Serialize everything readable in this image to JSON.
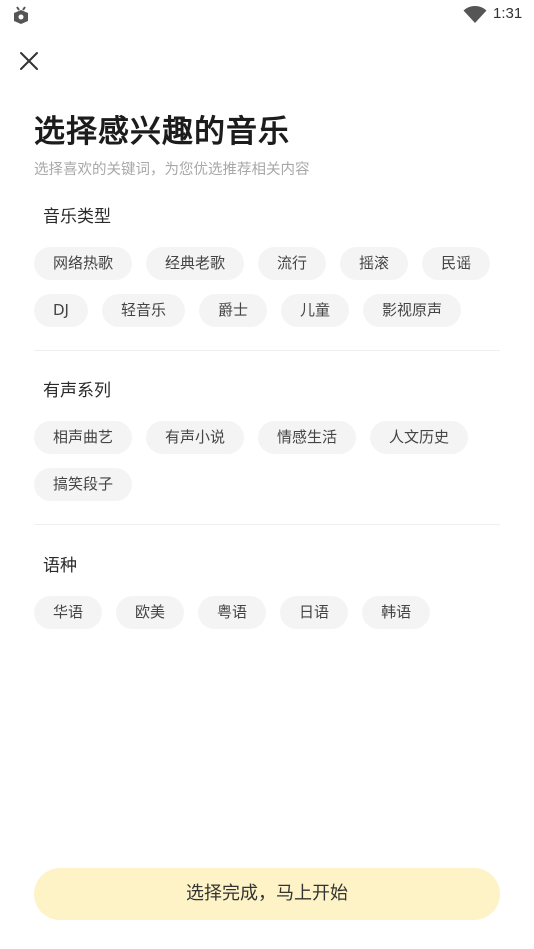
{
  "status_bar": {
    "time": "1:31",
    "icons": [
      "app-notification-icon",
      "wifi-icon"
    ]
  },
  "header": {
    "close_icon": "close-icon",
    "title": "选择感兴趣的音乐",
    "subtitle": "选择喜欢的关键词，为您优选推荐相关内容"
  },
  "sections": [
    {
      "title": "音乐类型",
      "tags": [
        "网络热歌",
        "经典老歌",
        "流行",
        "摇滚",
        "民谣",
        "DJ",
        "轻音乐",
        "爵士",
        "儿童",
        "影视原声"
      ]
    },
    {
      "title": "有声系列",
      "tags": [
        "相声曲艺",
        "有声小说",
        "情感生活",
        "人文历史",
        "搞笑段子"
      ]
    },
    {
      "title": "语种",
      "tags": [
        "华语",
        "欧美",
        "粤语",
        "日语",
        "韩语"
      ]
    }
  ],
  "footer": {
    "confirm_label": "选择完成，马上开始"
  },
  "colors": {
    "tag_bg": "#f4f4f4",
    "cta_bg": "#fdf3c7",
    "subtitle": "#a8a8a8"
  }
}
